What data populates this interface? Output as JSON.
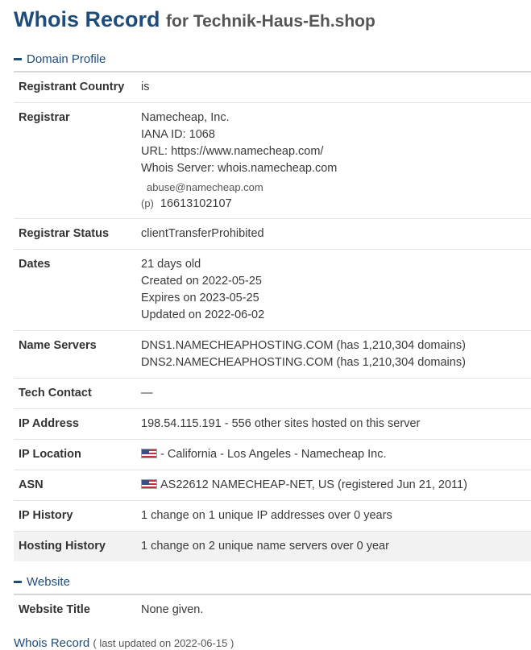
{
  "title": {
    "main": "Whois Record",
    "sub": "for Technik-Haus-Eh.shop"
  },
  "domain_profile": {
    "heading": "Domain Profile",
    "rows": {
      "registrant_country": {
        "label": "Registrant Country",
        "value": "is"
      },
      "registrar": {
        "label": "Registrar",
        "name": "Namecheap, Inc.",
        "iana": "IANA ID: 1068",
        "url": "URL: https://www.namecheap.com/",
        "whois": "Whois Server: whois.namecheap.com",
        "abuse_email": "abuse@namecheap.com",
        "phone_prefix": "(p)",
        "phone": "16613102107"
      },
      "registrar_status": {
        "label": "Registrar Status",
        "value": "clientTransferProhibited"
      },
      "dates": {
        "label": "Dates",
        "age": "21 days old",
        "created": "Created on 2022-05-25",
        "expires": "Expires on 2023-05-25",
        "updated": "Updated on 2022-06-02"
      },
      "name_servers": {
        "label": "Name Servers",
        "ns1": "DNS1.NAMECHEAPHOSTING.COM (has 1,210,304 domains)",
        "ns2": "DNS2.NAMECHEAPHOSTING.COM (has 1,210,304 domains)"
      },
      "tech_contact": {
        "label": "Tech Contact",
        "value": "—"
      },
      "ip_address": {
        "label": "IP Address",
        "value": "198.54.115.191 - 556 other sites hosted on this server"
      },
      "ip_location": {
        "label": "IP Location",
        "value": "- California - Los Angeles - Namecheap Inc.",
        "flag_icon": "us-flag-icon"
      },
      "asn": {
        "label": "ASN",
        "value": "AS22612 NAMECHEAP-NET, US (registered Jun 21, 2011)",
        "flag_icon": "us-flag-icon"
      },
      "ip_history": {
        "label": "IP History",
        "value": "1 change on 1 unique IP addresses over 0 years"
      },
      "hosting_history": {
        "label": "Hosting History",
        "value": "1 change on 2 unique name servers over 0 year"
      }
    }
  },
  "website": {
    "heading": "Website",
    "title_label": "Website Title",
    "title_value": "None given."
  },
  "footer": {
    "link": "Whois Record",
    "updated": "( last updated on 2022-06-15 )"
  },
  "colors": {
    "accent": "#1e4d7b",
    "shade": "#f2f2f2"
  }
}
